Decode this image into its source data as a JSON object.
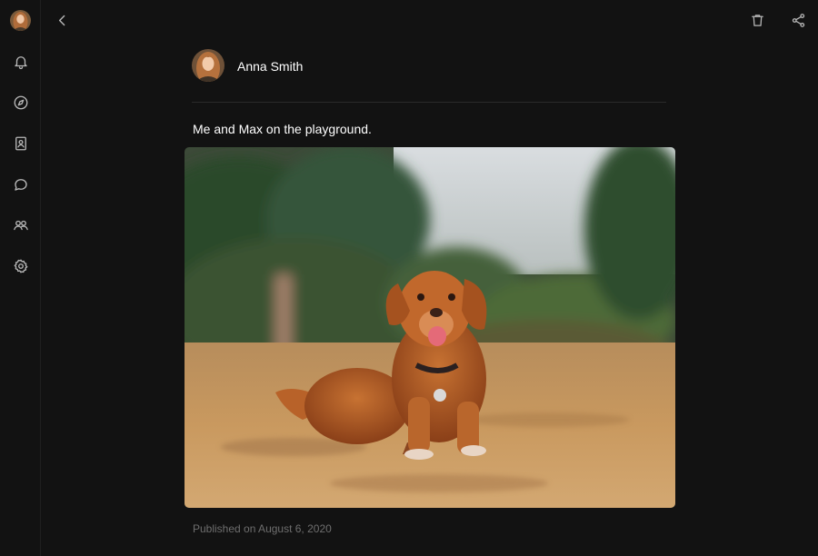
{
  "sidebar": {
    "items": [
      {
        "icon": "bell-icon"
      },
      {
        "icon": "compass-icon"
      },
      {
        "icon": "contact-book-icon"
      },
      {
        "icon": "chat-bubble-icon"
      },
      {
        "icon": "users-icon"
      },
      {
        "icon": "gear-icon"
      }
    ]
  },
  "toolbar": {
    "back_icon": "chevron-left-icon",
    "delete_icon": "trash-icon",
    "share_icon": "share-icon"
  },
  "post": {
    "author": "Anna Smith",
    "caption": "Me and Max on the playground.",
    "published": "Published on August 6, 2020"
  },
  "colors": {
    "background": "#121212",
    "text": "#ffffff",
    "muted": "#6e6e6e",
    "icon": "#b8b8b8"
  }
}
